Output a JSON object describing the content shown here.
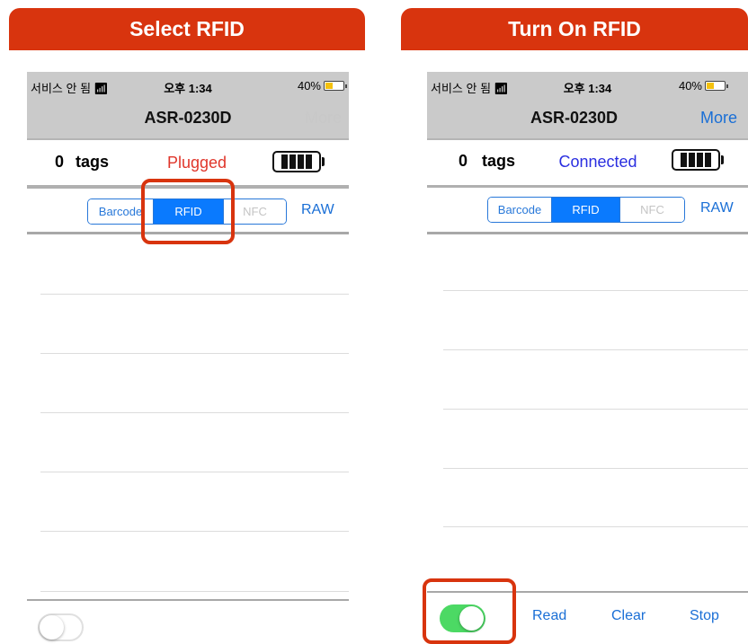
{
  "left": {
    "banner": "Select RFID",
    "status": {
      "carrier": "서비스 안 됨",
      "time": "오후 1:34",
      "battery": "40%",
      "battery_level": 0.4
    },
    "nav": {
      "title": "ASR-0230D",
      "more": "More",
      "more_enabled": false
    },
    "tags": {
      "count": "0",
      "label": "tags"
    },
    "connection": {
      "text": "Plugged",
      "color": "#e0362b"
    },
    "device_battery_level": 1.0,
    "segments": [
      {
        "label": "Barcode",
        "state": "normal"
      },
      {
        "label": "RFID",
        "state": "selected"
      },
      {
        "label": "NFC",
        "state": "disabled"
      }
    ],
    "raw": "RAW",
    "toggle": {
      "on": false
    }
  },
  "right": {
    "banner": "Turn On  RFID",
    "status": {
      "carrier": "서비스 안 됨",
      "time": "오후 1:34",
      "battery": "40%",
      "battery_level": 0.4
    },
    "nav": {
      "title": "ASR-0230D",
      "more": "More",
      "more_enabled": true
    },
    "tags": {
      "count": "0",
      "label": "tags"
    },
    "connection": {
      "text": "Connected",
      "color": "#2a2ee0"
    },
    "device_battery_level": 1.0,
    "segments": [
      {
        "label": "Barcode",
        "state": "normal"
      },
      {
        "label": "RFID",
        "state": "selected"
      },
      {
        "label": "NFC",
        "state": "disabled"
      }
    ],
    "raw": "RAW",
    "toggle": {
      "on": true
    },
    "toolbar": {
      "read": "Read",
      "clear": "Clear",
      "stop": "Stop"
    }
  },
  "colors": {
    "accent_red": "#d8340e",
    "ios_blue": "#0a7afe",
    "toggle_on": "#4cd964"
  }
}
